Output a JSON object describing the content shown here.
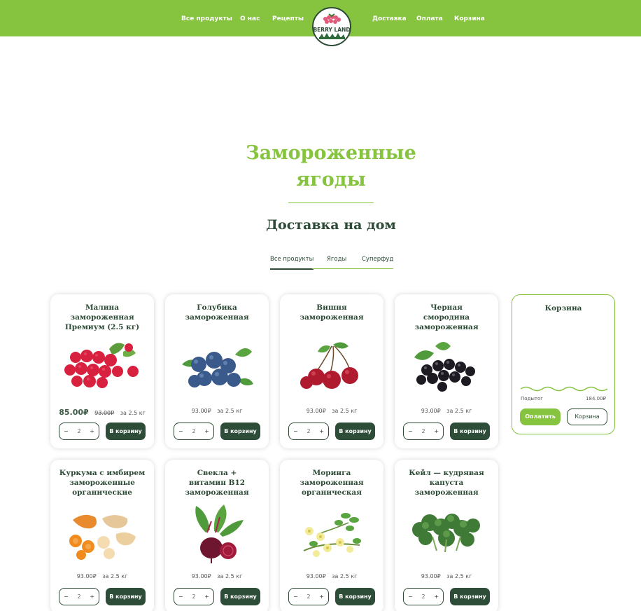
{
  "header": {
    "nav_left": [
      "Все продукты",
      "О нас",
      "Рецепты"
    ],
    "nav_right": [
      "Доставка",
      "Оплата",
      "Корзина"
    ],
    "logo_text": "BERRY LAND"
  },
  "hero": {
    "title_line1": "Замороженные",
    "title_line2": "ягоды",
    "subtitle": "Доставка на дом"
  },
  "filters": {
    "tabs": [
      "Все продукты",
      "Ягоды",
      "Суперфуд"
    ],
    "active": "Все продукты"
  },
  "products": [
    {
      "title_lines": [
        "Малина",
        "замороженная",
        "Премиум (2.5 кг)"
      ],
      "price_sale": "85.00₽",
      "price_old": "93.00₽",
      "unit": "за 2.5 кг",
      "qty": "2",
      "add_label": "В корзину",
      "image": "raspberry"
    },
    {
      "title_lines": [
        "Голубика",
        "замороженная"
      ],
      "price": "93.00₽",
      "unit": "за 2.5 кг",
      "qty": "2",
      "add_label": "В корзину",
      "image": "blueberry"
    },
    {
      "title_lines": [
        "Вишня",
        "замороженная"
      ],
      "price": "93.00₽",
      "unit": "за 2.5 кг",
      "qty": "2",
      "add_label": "В корзину",
      "image": "cherry"
    },
    {
      "title_lines": [
        "Черная",
        "смородина",
        "замороженная"
      ],
      "price": "93.00₽",
      "unit": "за 2.5 кг",
      "qty": "2",
      "add_label": "В корзину",
      "image": "blackcurrant"
    },
    {
      "title_lines": [
        "Куркума с имбирем",
        "замороженные",
        "органические"
      ],
      "price": "93.00₽",
      "unit": "за 2.5 кг",
      "qty": "2",
      "add_label": "В корзину",
      "image": "turmeric-ginger"
    },
    {
      "title_lines": [
        "Свекла +",
        "витамин B12",
        "замороженная"
      ],
      "price": "93.00₽",
      "unit": "за 2.5 кг",
      "qty": "2",
      "add_label": "В корзину",
      "image": "beetroot"
    },
    {
      "title_lines": [
        "Моринга",
        "замороженная",
        "органическая"
      ],
      "price": "93.00₽",
      "unit": "за 2.5 кг",
      "qty": "2",
      "add_label": "В корзину",
      "image": "moringa"
    },
    {
      "title_lines": [
        "Кейл — кудрявая",
        "капуста",
        "замороженная"
      ],
      "price": "93.00₽",
      "unit": "за 2.5 кг",
      "qty": "2",
      "add_label": "В корзину",
      "image": "kale"
    }
  ],
  "cart": {
    "title": "Корзина",
    "subtotal_label": "Подытог",
    "subtotal_value": "184.00₽",
    "pay_label": "Оплатить",
    "cart_label": "Корзина"
  },
  "colors": {
    "brand_green": "#86c440",
    "dark_green": "#2e4d38"
  }
}
